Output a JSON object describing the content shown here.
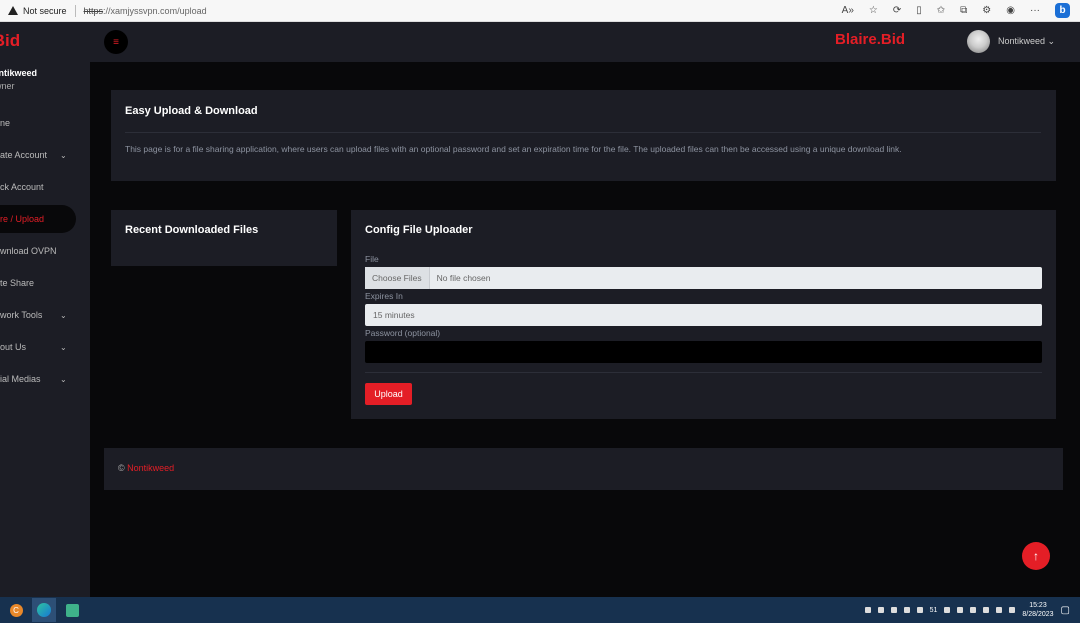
{
  "browser": {
    "security_label": "Not secure",
    "url_scheme": "https",
    "url_rest": "://xamjyssvpn.com/upload"
  },
  "sidebar": {
    "brand": ".Bid",
    "user_name": "ontikweed",
    "user_role": "wner",
    "items": [
      {
        "label": "ne",
        "has_chevron": false
      },
      {
        "label": "ate Account",
        "has_chevron": true
      },
      {
        "label": "ck Account",
        "has_chevron": false
      },
      {
        "label": "re / Upload",
        "has_chevron": false,
        "active": true
      },
      {
        "label": "wnload OVPN",
        "has_chevron": false
      },
      {
        "label": "te Share",
        "has_chevron": false
      },
      {
        "label": "work Tools",
        "has_chevron": true
      },
      {
        "label": "out Us",
        "has_chevron": true
      },
      {
        "label": "ial Medias",
        "has_chevron": true
      }
    ]
  },
  "topbar": {
    "brand": "Blaire.Bid",
    "user_name": "Nontikweed"
  },
  "intro_card": {
    "title": "Easy Upload & Download",
    "text": "This page is for a file sharing application, where users can upload files with an optional password and set an expiration time for the file. The uploaded files can then be accessed using a unique download link."
  },
  "recent_card": {
    "title": "Recent Downloaded Files"
  },
  "uploader_card": {
    "title": "Config File Uploader",
    "file_label": "File",
    "choose_button": "Choose Files",
    "file_status": "No file chosen",
    "expires_label": "Expires In",
    "expires_value": "15 minutes",
    "password_label": "Password (optional)",
    "upload_button": "Upload"
  },
  "footer": {
    "copyright": "©",
    "owner": "Nontikweed"
  },
  "taskbar": {
    "tray_number": "51",
    "time": "15:23",
    "date": "8/28/2023"
  },
  "colors": {
    "accent": "#e41e26",
    "panel": "#1c1d25",
    "background": "#08080a"
  }
}
